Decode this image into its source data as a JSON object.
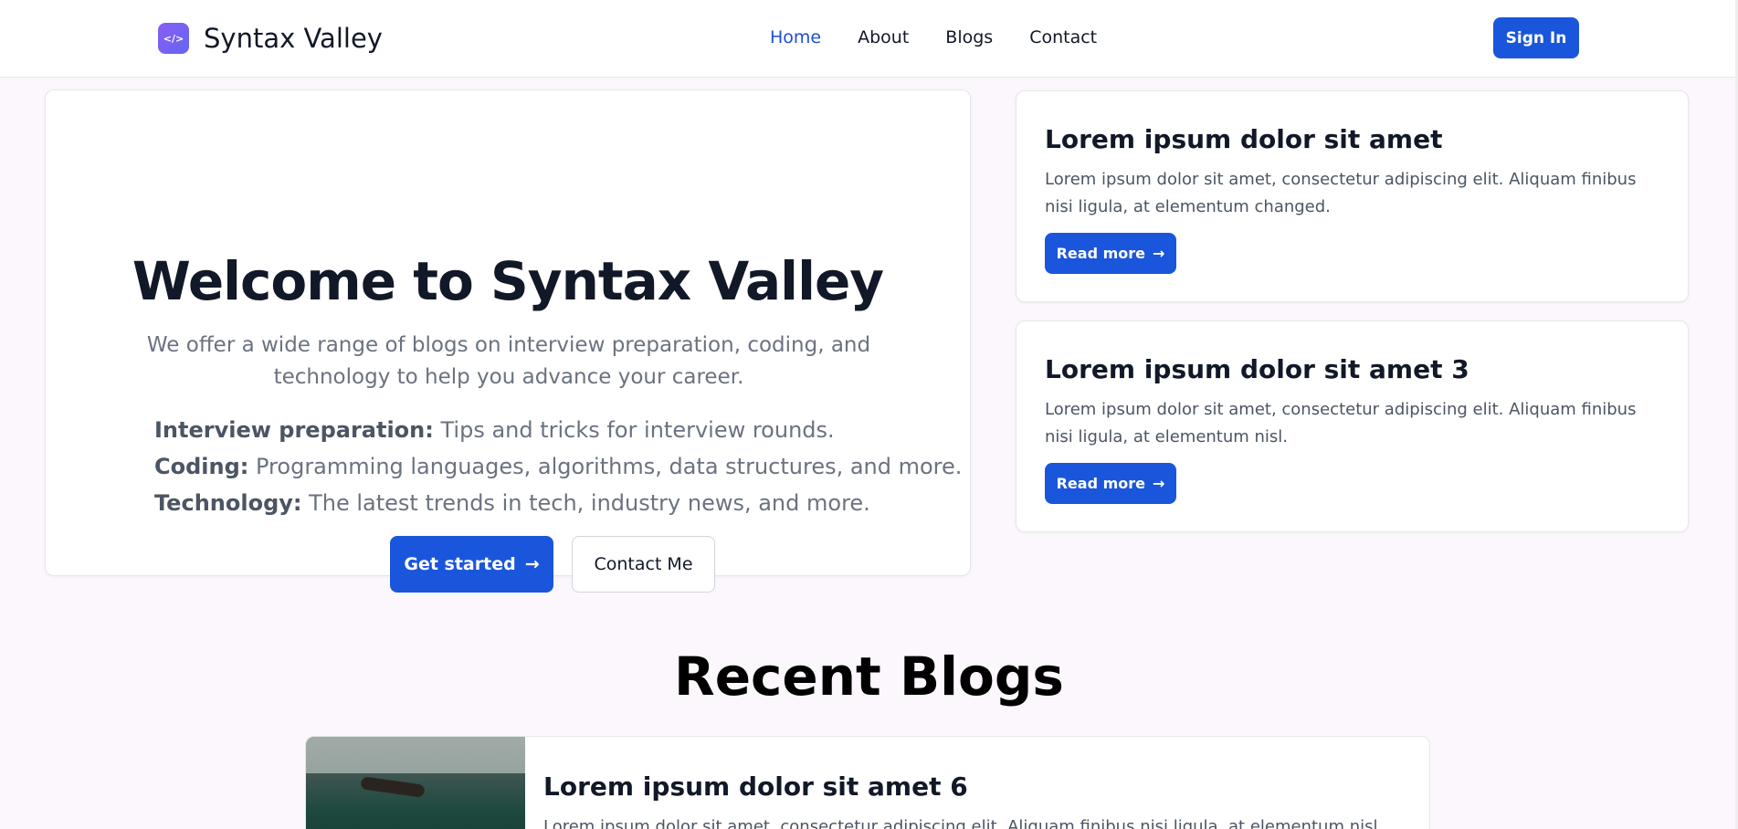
{
  "header": {
    "logo_icon_glyph": "</>",
    "brand": "Syntax Valley",
    "nav": [
      {
        "label": "Home",
        "active": true
      },
      {
        "label": "About",
        "active": false
      },
      {
        "label": "Blogs",
        "active": false
      },
      {
        "label": "Contact",
        "active": false
      }
    ],
    "signin_label": "Sign In"
  },
  "hero": {
    "title": "Welcome to Syntax Valley",
    "subtitle": "We offer a wide range of blogs on interview preparation, coding, and technology to help you advance your career.",
    "features": [
      {
        "term": "Interview preparation:",
        "text": " Tips and tricks for interview rounds."
      },
      {
        "term": "Coding:",
        "text": " Programming languages, algorithms, data structures, and more."
      },
      {
        "term": "Technology:",
        "text": " The latest trends in tech, industry news, and more."
      }
    ],
    "primary_button": "Get started",
    "secondary_button": "Contact Me",
    "arrow": "→"
  },
  "side_posts": [
    {
      "title": "Lorem ipsum dolor sit amet",
      "description": "Lorem ipsum dolor sit amet, consectetur adipiscing elit. Aliquam finibus nisi ligula, at elementum changed.",
      "button": "Read more"
    },
    {
      "title": "Lorem ipsum dolor sit amet 3",
      "description": "Lorem ipsum dolor sit amet, consectetur adipiscing elit. Aliquam finibus nisi ligula, at elementum nisl.",
      "button": "Read more"
    }
  ],
  "recent": {
    "heading": "Recent Blogs",
    "posts": [
      {
        "title": "Lorem ipsum dolor sit amet 6",
        "description": "Lorem ipsum dolor sit amet, consectetur adipiscing elit. Aliquam finibus nisi ligula, at elementum nisl."
      }
    ]
  },
  "colors": {
    "accent": "#1a56db",
    "background": "#fcf7fc",
    "logo_gradient_start": "#8b5cf6"
  }
}
